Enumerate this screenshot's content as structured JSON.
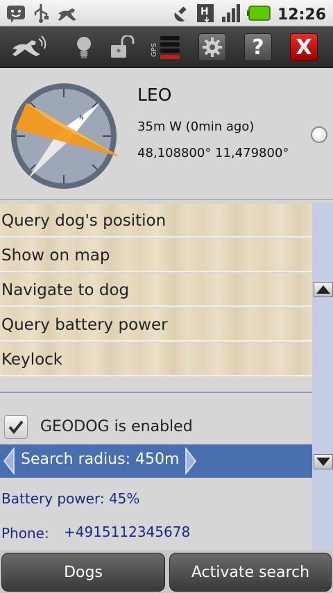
{
  "status_bar": {
    "time": "12:26",
    "icons": [
      "notification-smiley-icon",
      "usb-icon",
      "dog-running-icon",
      "gps-satellite-icon",
      "network-h-icon",
      "signal-bars-icon",
      "battery-icon"
    ],
    "colors": {
      "battery": "#5ec800"
    }
  },
  "toolbar": {
    "icons": [
      "dog-tracker-logo-icon",
      "lightbulb-icon",
      "lock-open-icon",
      "gps-status-icon",
      "settings-gear-icon",
      "help-icon",
      "close-icon"
    ],
    "help_label": "?",
    "close_label": "X",
    "gps_label": "GPS"
  },
  "dog": {
    "name": "LEO",
    "distance": "35m W (0min ago)",
    "coordinates": "48,108800° 11,479800°"
  },
  "compass": {
    "letter": "N",
    "colors": {
      "needle": "#f39a1a",
      "face": "#9ea7b8"
    }
  },
  "menu": {
    "items": [
      {
        "label": "Query dog's position"
      },
      {
        "label": "Show on map"
      },
      {
        "label": "Navigate to dog"
      },
      {
        "label": "Query battery power"
      },
      {
        "label": "Keylock"
      }
    ]
  },
  "settings": {
    "geodog_label": "GEODOG is enabled",
    "geodog_checked": true,
    "search_radius": "Search radius: 450m",
    "battery": "Battery power: 45%",
    "phone_label": "Phone:",
    "phone_value": "+4915112345678"
  },
  "bottom": {
    "dogs_label": "Dogs",
    "activate_label": "Activate search"
  }
}
